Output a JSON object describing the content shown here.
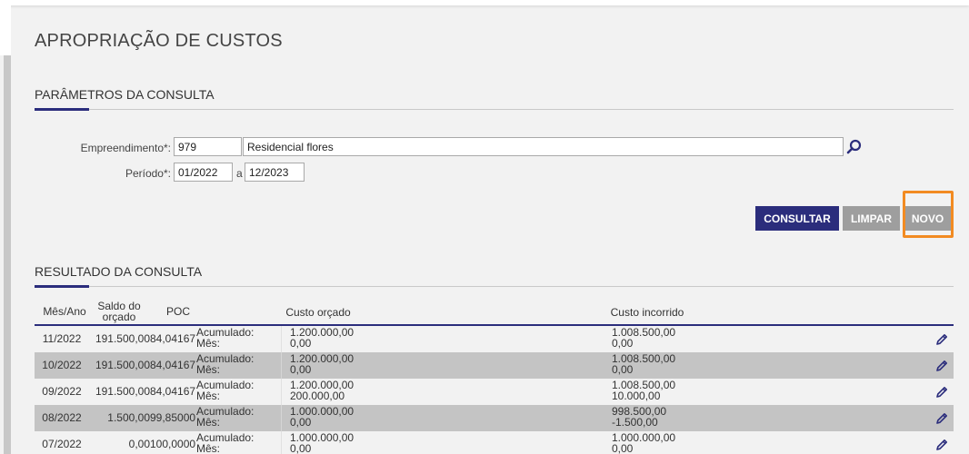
{
  "page": {
    "title": "APROPRIAÇÃO DE CUSTOS"
  },
  "params": {
    "section_title": "PARÂMETROS DA CONSULTA",
    "empreendimento_label": "Empreendimento*:",
    "empreendimento_code": "979",
    "empreendimento_name": "Residencial flores",
    "periodo_label": "Período*:",
    "periodo_start": "01/2022",
    "periodo_sep": "a",
    "periodo_end": "12/2023"
  },
  "buttons": {
    "consultar": "CONSULTAR",
    "limpar": "LIMPAR",
    "novo": "NOVO"
  },
  "results": {
    "section_title": "RESULTADO DA CONSULTA",
    "headers": {
      "mes_ano": "Mês/Ano",
      "saldo_line1": "Saldo do",
      "saldo_line2": "orçado",
      "poc": "POC",
      "custo_orcado": "Custo orçado",
      "custo_incorrido": "Custo incorrido"
    },
    "rows": [
      {
        "mes": "11/2022",
        "saldo": "191.500,00",
        "poc": "84,04167",
        "lbl_acum": "Acumulado:",
        "lbl_mes": "Mês:",
        "orc_acum": "1.200.000,00",
        "orc_mes": "0,00",
        "inc_acum": "1.008.500,00",
        "inc_mes": "0,00"
      },
      {
        "mes": "10/2022",
        "saldo": "191.500,00",
        "poc": "84,04167",
        "lbl_acum": "Acumulado:",
        "lbl_mes": "Mês:",
        "orc_acum": "1.200.000,00",
        "orc_mes": "0,00",
        "inc_acum": "1.008.500,00",
        "inc_mes": "0,00"
      },
      {
        "mes": "09/2022",
        "saldo": "191.500,00",
        "poc": "84,04167",
        "lbl_acum": "Acumulado:",
        "lbl_mes": "Mês:",
        "orc_acum": "1.200.000,00",
        "orc_mes": "200.000,00",
        "inc_acum": "1.008.500,00",
        "inc_mes": "10.000,00"
      },
      {
        "mes": "08/2022",
        "saldo": "1.500,00",
        "poc": "99,85000",
        "lbl_acum": "Acumulado:",
        "lbl_mes": "Mês:",
        "orc_acum": "1.000.000,00",
        "orc_mes": "0,00",
        "inc_acum": "998.500,00",
        "inc_mes": "-1.500,00"
      },
      {
        "mes": "07/2022",
        "saldo": "0,00",
        "poc": "100,0000",
        "lbl_acum": "Acumulado:",
        "lbl_mes": "Mês:",
        "orc_acum": "1.000.000,00",
        "orc_mes": "0,00",
        "inc_acum": "1.000.000,00",
        "inc_mes": "0,00"
      }
    ]
  },
  "colors": {
    "primary": "#2b2d7c",
    "highlight": "#f28b22",
    "row_alt": "#c4c4c4"
  },
  "icons": {
    "search": "search-icon",
    "edit": "pencil-icon"
  }
}
